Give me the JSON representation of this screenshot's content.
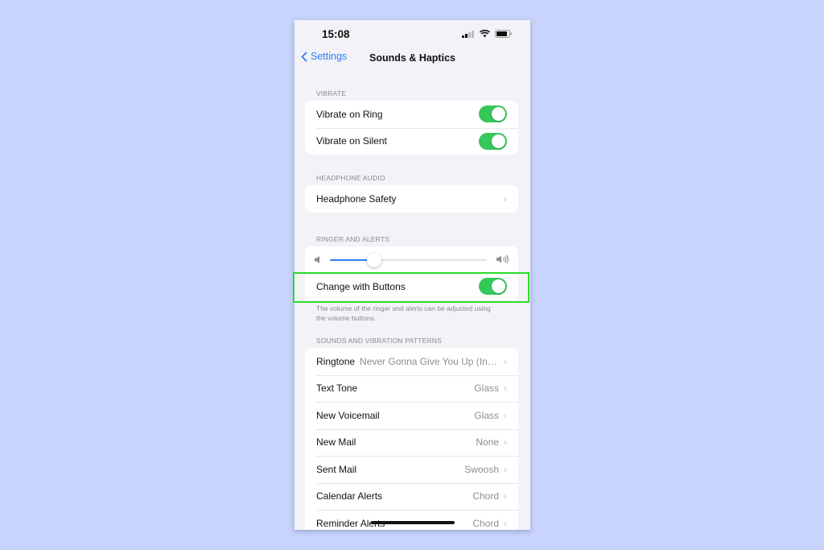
{
  "status_bar": {
    "time": "15:08",
    "icons": [
      "cellular-signal-icon",
      "wifi-icon",
      "battery-icon"
    ]
  },
  "nav": {
    "back_label": "Settings",
    "title": "Sounds & Haptics"
  },
  "sections": {
    "vibrate": {
      "header": "VIBRATE",
      "rows": [
        {
          "label": "Vibrate on Ring",
          "toggle": true
        },
        {
          "label": "Vibrate on Silent",
          "toggle": true
        }
      ]
    },
    "headphone": {
      "header": "HEADPHONE AUDIO",
      "rows": [
        {
          "label": "Headphone Safety"
        }
      ]
    },
    "ringer": {
      "header": "RINGER AND ALERTS",
      "volume_level": 0.28,
      "change_with_buttons": {
        "label": "Change with Buttons",
        "toggle": true
      },
      "footer": "The volume of the ringer and alerts can be adjusted using the volume buttons."
    },
    "patterns": {
      "header": "SOUNDS AND VIBRATION PATTERNS",
      "rows": [
        {
          "label": "Ringtone",
          "value": "Never Gonna Give You Up (Intro..."
        },
        {
          "label": "Text Tone",
          "value": "Glass"
        },
        {
          "label": "New Voicemail",
          "value": "Glass"
        },
        {
          "label": "New Mail",
          "value": "None"
        },
        {
          "label": "Sent Mail",
          "value": "Swoosh"
        },
        {
          "label": "Calendar Alerts",
          "value": "Chord"
        },
        {
          "label": "Reminder Alerts",
          "value": "Chord"
        }
      ]
    }
  },
  "colors": {
    "accent": "#2f7cf6",
    "toggle_on": "#34c759",
    "highlight": "#2ddc2b",
    "background": "#c8d4fc"
  }
}
